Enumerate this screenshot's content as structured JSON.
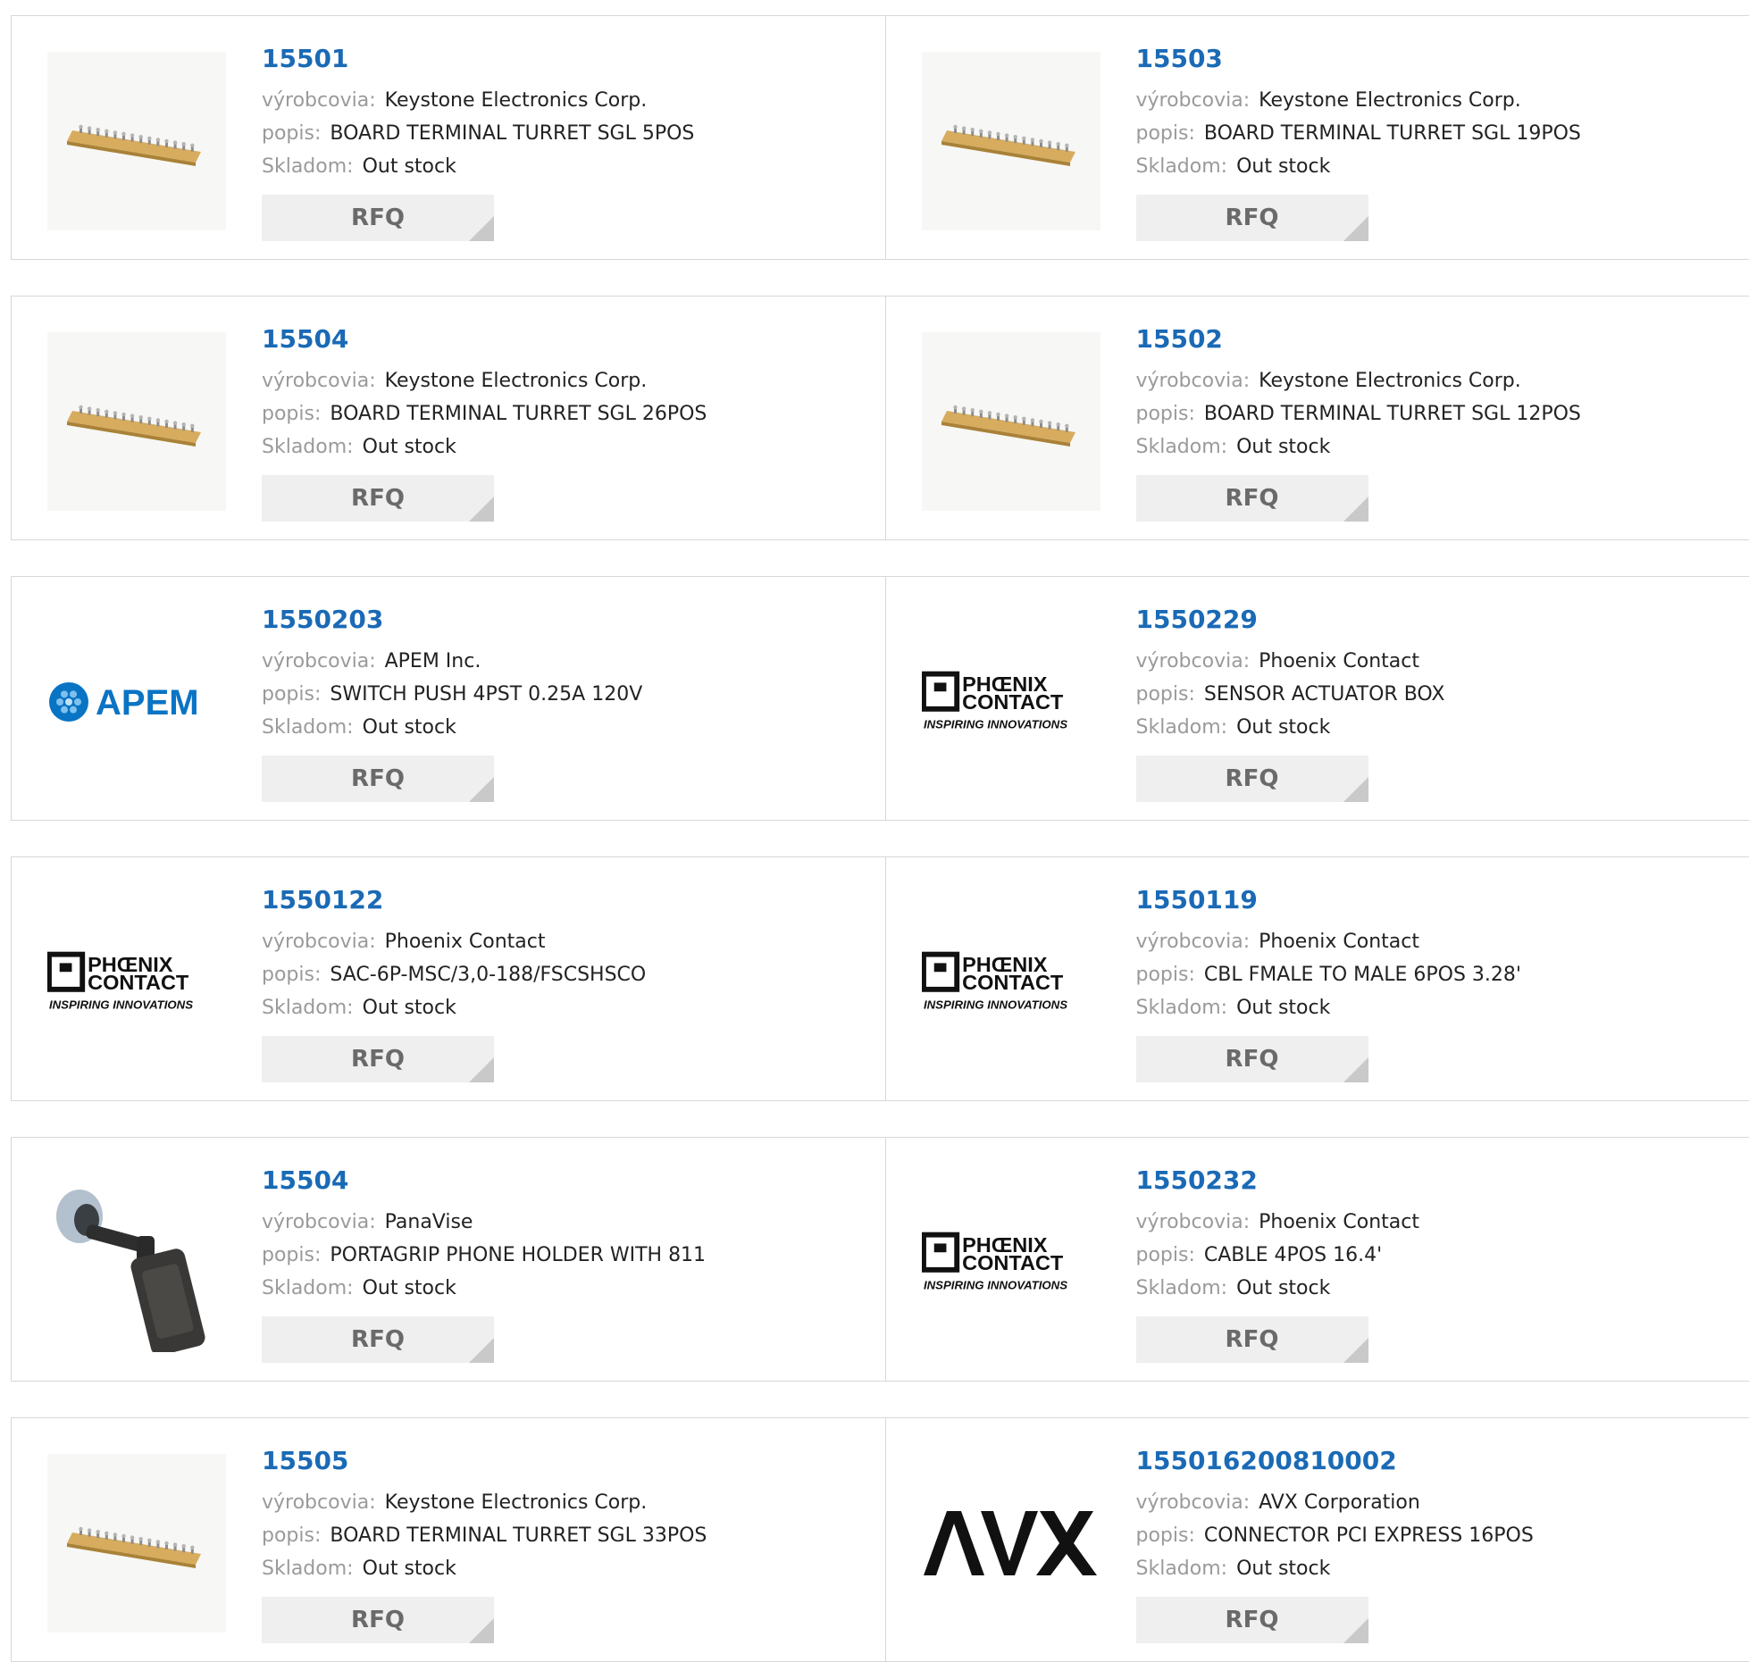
{
  "labels": {
    "manufacturer": "výrobcovia:",
    "description": "popis:",
    "stock": "Skladom:",
    "rfq": "RFQ"
  },
  "products": [
    {
      "pn": "15501",
      "manufacturer": "Keystone Electronics Corp.",
      "description": "BOARD TERMINAL TURRET SGL 5POS",
      "stock": "Out stock",
      "image": "terminal-strip"
    },
    {
      "pn": "15503",
      "manufacturer": "Keystone Electronics Corp.",
      "description": "BOARD TERMINAL TURRET SGL 19POS",
      "stock": "Out stock",
      "image": "terminal-strip"
    },
    {
      "pn": "15504",
      "manufacturer": "Keystone Electronics Corp.",
      "description": "BOARD TERMINAL TURRET SGL 26POS",
      "stock": "Out stock",
      "image": "terminal-strip"
    },
    {
      "pn": "15502",
      "manufacturer": "Keystone Electronics Corp.",
      "description": "BOARD TERMINAL TURRET SGL 12POS",
      "stock": "Out stock",
      "image": "terminal-strip"
    },
    {
      "pn": "1550203",
      "manufacturer": "APEM Inc.",
      "description": "SWITCH PUSH 4PST 0.25A 120V",
      "stock": "Out stock",
      "image": "apem-logo"
    },
    {
      "pn": "1550229",
      "manufacturer": "Phoenix Contact",
      "description": "SENSOR ACTUATOR BOX",
      "stock": "Out stock",
      "image": "phoenix-logo"
    },
    {
      "pn": "1550122",
      "manufacturer": "Phoenix Contact",
      "description": "SAC-6P-MSC/3,0-188/FSCSHSCO",
      "stock": "Out stock",
      "image": "phoenix-logo"
    },
    {
      "pn": "1550119",
      "manufacturer": "Phoenix Contact",
      "description": "CBL FMALE TO MALE 6POS 3.28'",
      "stock": "Out stock",
      "image": "phoenix-logo"
    },
    {
      "pn": "15504",
      "manufacturer": "PanaVise",
      "description": "PORTAGRIP PHONE HOLDER WITH 811",
      "stock": "Out stock",
      "image": "phone-holder"
    },
    {
      "pn": "1550232",
      "manufacturer": "Phoenix Contact",
      "description": "CABLE 4POS 16.4'",
      "stock": "Out stock",
      "image": "phoenix-logo"
    },
    {
      "pn": "15505",
      "manufacturer": "Keystone Electronics Corp.",
      "description": "BOARD TERMINAL TURRET SGL 33POS",
      "stock": "Out stock",
      "image": "terminal-strip"
    },
    {
      "pn": "155016200810002",
      "manufacturer": "AVX Corporation",
      "description": "CONNECTOR PCI EXPRESS 16POS",
      "stock": "Out stock",
      "image": "avx-logo"
    }
  ],
  "logos": {
    "apem": "APEM",
    "phoenix_line1": "PHŒNIX",
    "phoenix_line2": "CONTACT",
    "phoenix_tagline": "INSPIRING INNOVATIONS",
    "avx": "AVX"
  },
  "colors": {
    "part_number": "#1a6ab5",
    "label": "#9a9a9a",
    "button_bg": "#efefef",
    "apem_blue": "#0a74c4"
  }
}
